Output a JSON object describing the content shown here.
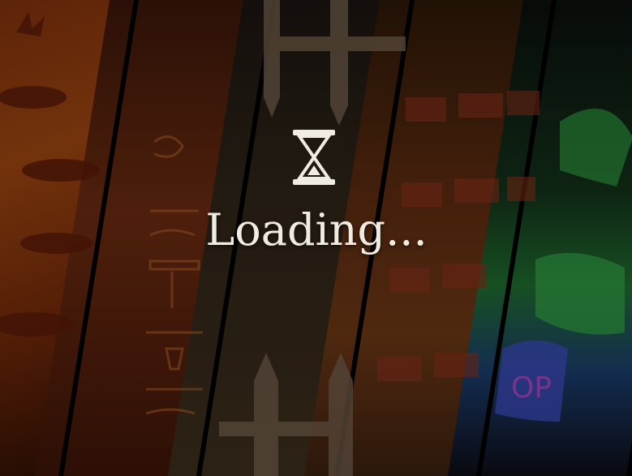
{
  "loading": {
    "text": "Loading...",
    "icon": "hourglass-icon"
  },
  "panels": [
    "cave-painting",
    "egyptian-hieroglyphs",
    "wooden-fence",
    "brick-wall",
    "graffiti"
  ],
  "colors": {
    "text": "#f1ece2",
    "cave": "#9a4410",
    "brick": "#6a3615",
    "graffiti_green": "#1f6a2e",
    "graffiti_blue": "#1a3c6a"
  }
}
